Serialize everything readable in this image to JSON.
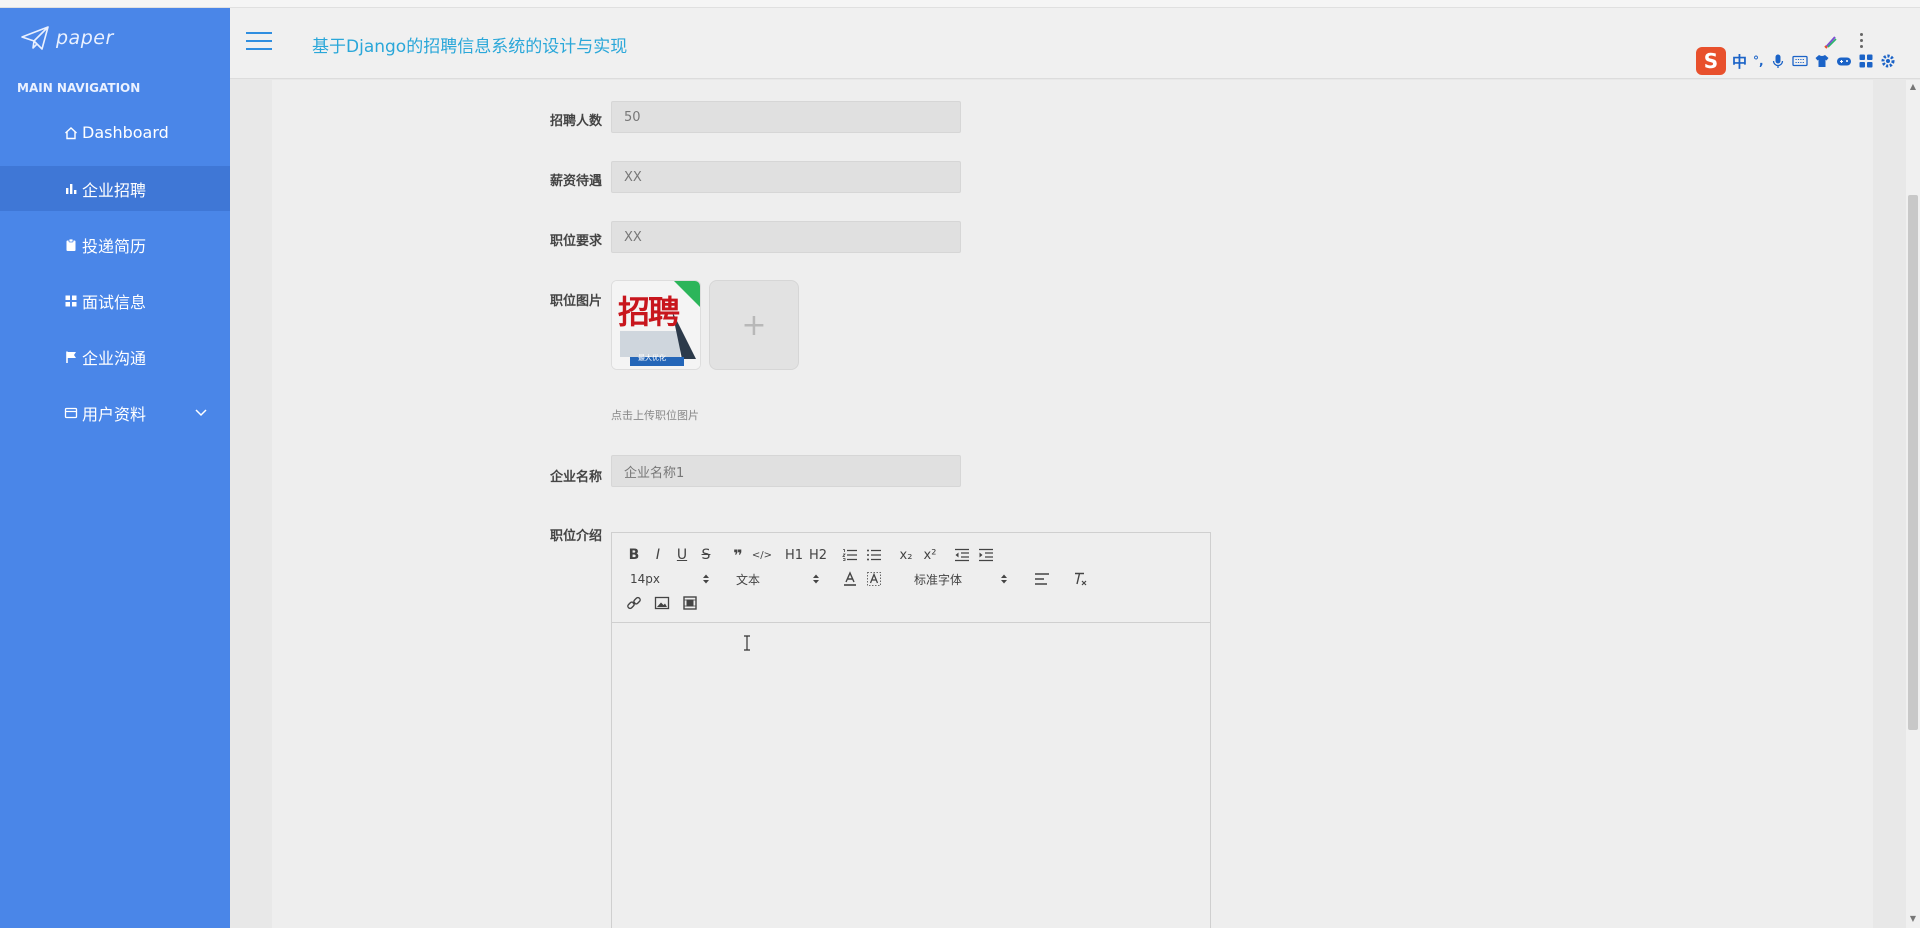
{
  "brand": {
    "name": "paper"
  },
  "sidebar": {
    "heading": "MAIN NAVIGATION",
    "items": [
      {
        "label": "Dashboard",
        "icon": "home-icon"
      },
      {
        "label": "企业招聘",
        "icon": "bar-chart-icon",
        "active": true
      },
      {
        "label": "投递简历",
        "icon": "clipboard-icon"
      },
      {
        "label": "面试信息",
        "icon": "grid-icon"
      },
      {
        "label": "企业沟通",
        "icon": "flag-icon"
      },
      {
        "label": "用户资料",
        "icon": "profile-icon",
        "has_submenu": true
      }
    ]
  },
  "header": {
    "title": "基于Django的招聘信息系统的设计与实现"
  },
  "ime": {
    "logo": "S",
    "mode": "中",
    "punct": "°,"
  },
  "form": {
    "headcount": {
      "label": "招聘人数",
      "value": "50"
    },
    "salary": {
      "label": "薪资待遇",
      "value": "XX"
    },
    "requirements": {
      "label": "职位要求",
      "value": "XX"
    },
    "image": {
      "label": "职位图片",
      "hint": "点击上传职位图片",
      "thumb_text": "招聘",
      "thumb_sub": "最大优化",
      "add_symbol": "+"
    },
    "company": {
      "label": "企业名称",
      "value": "企业名称1"
    },
    "intro": {
      "label": "职位介绍"
    }
  },
  "editor": {
    "buttons_row1": [
      "B",
      "I",
      "U",
      "S",
      "❞",
      "</>",
      "H1",
      "H2",
      "ol",
      "ul",
      "x₂",
      "x²",
      "outdent",
      "indent"
    ],
    "font_size": "14px",
    "heading_select": "文本",
    "font_family": "标准字体"
  },
  "colors": {
    "sidebar": "#4a86e8",
    "sidebar_active": "#3f77d6",
    "title": "#2aa7d9",
    "ime_logo": "#e8502c"
  }
}
